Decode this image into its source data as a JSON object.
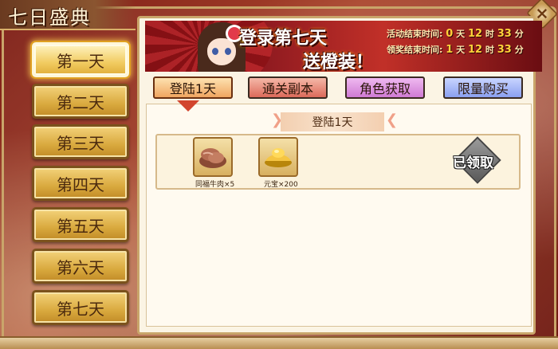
{
  "window": {
    "title": "七日盛典",
    "close_label": "×"
  },
  "days": [
    {
      "label": "第一天",
      "active": true
    },
    {
      "label": "第二天",
      "active": false
    },
    {
      "label": "第三天",
      "active": false
    },
    {
      "label": "第四天",
      "active": false
    },
    {
      "label": "第五天",
      "active": false
    },
    {
      "label": "第六天",
      "active": false
    },
    {
      "label": "第七天",
      "active": false
    }
  ],
  "banner": {
    "line1": "登录第七天",
    "line2": "送橙装！",
    "activity_end": {
      "label": "活动结束时间:",
      "days": "0",
      "d_unit": "天",
      "hours": "12",
      "h_unit": "时",
      "minutes": "33",
      "m_unit": "分"
    },
    "reward_end": {
      "label": "领奖结束时间:",
      "days": "1",
      "d_unit": "天",
      "hours": "12",
      "h_unit": "时",
      "minutes": "33",
      "m_unit": "分"
    }
  },
  "tabs": [
    {
      "label": "登陆1天",
      "active": true
    },
    {
      "label": "通关副本",
      "active": false
    },
    {
      "label": "角色获取",
      "active": false
    },
    {
      "label": "限量购买",
      "active": false
    }
  ],
  "section": {
    "title": "登陆1天"
  },
  "rewards": [
    {
      "name": "同福牛肉×5",
      "icon": "beef-icon"
    },
    {
      "name": "元宝×200",
      "icon": "gold-ingot-icon"
    }
  ],
  "claim_status": "已领取",
  "colors": {
    "frame": "#c9a56a",
    "day_button": "#d9a93e",
    "banner": "#8f1a20"
  }
}
